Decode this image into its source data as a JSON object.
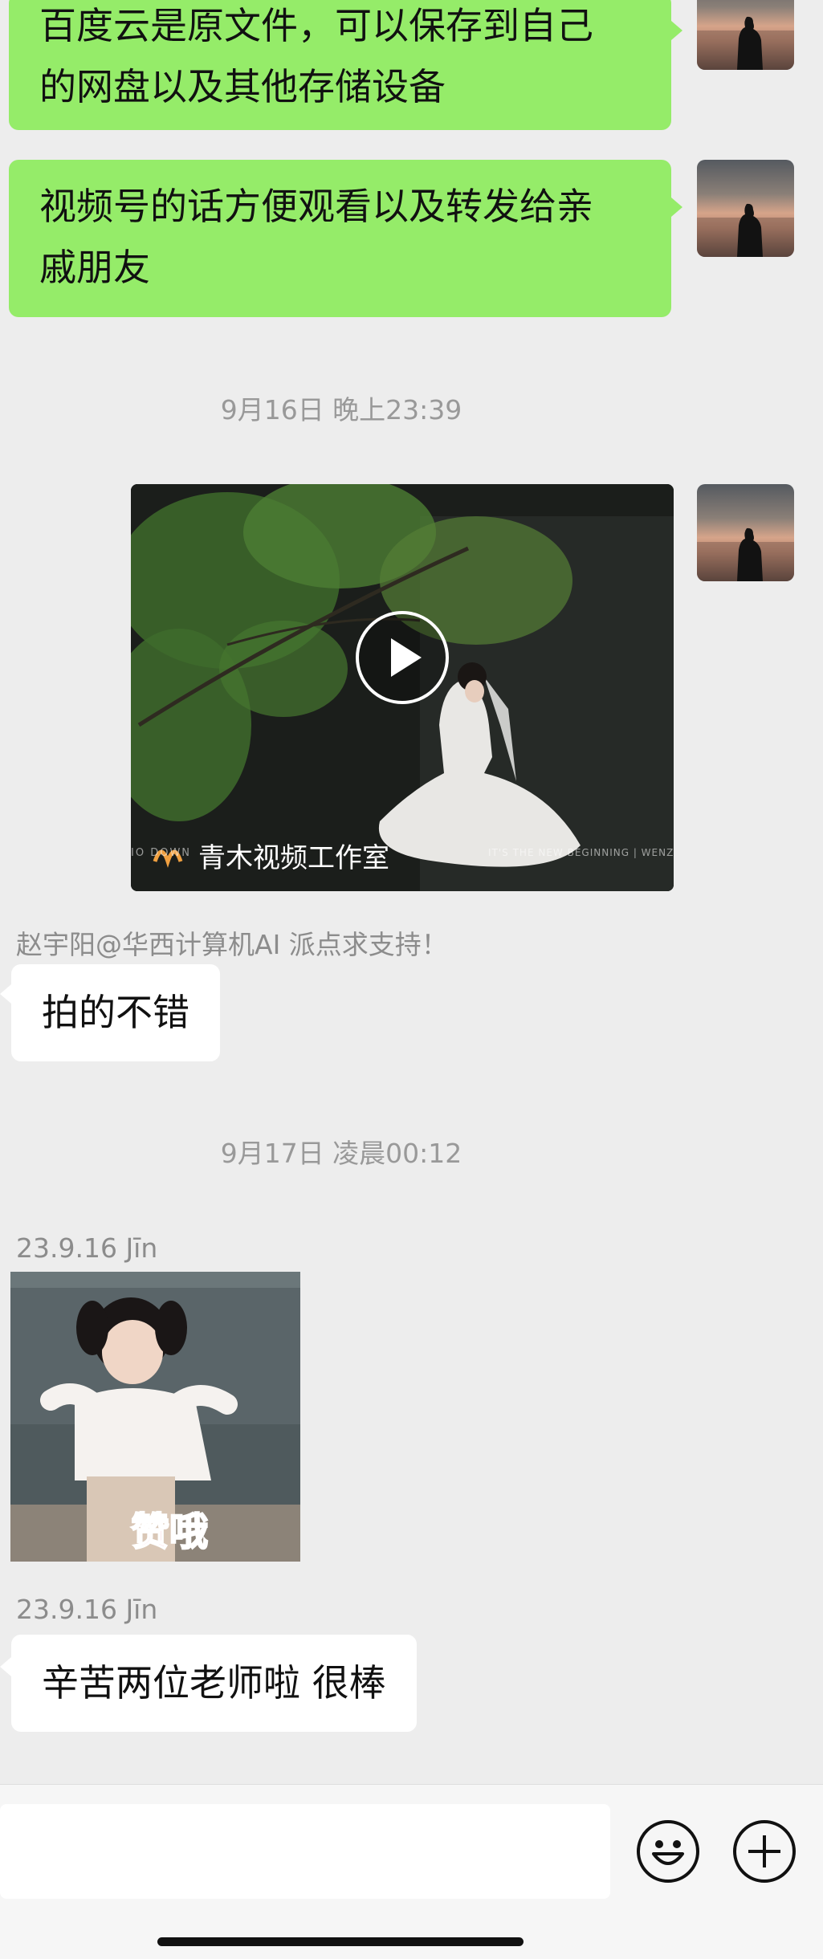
{
  "messages": {
    "m1_lines": [
      "百度云是原文件，可以保存到自己",
      "的网盘以及其他存储设备"
    ],
    "m2_lines": [
      "视频号的话方便观看以及转发给亲",
      "戚朋友"
    ],
    "timestamp1": "9月16日 晚上23:39",
    "video": {
      "channel_name": "青木视频工作室",
      "overlay_left": "IO DOWN",
      "overlay_right": "IT'S THE NEW BEGINNING | WENZ"
    },
    "sender_1": "赵宇阳@华西计算机AI 派点求支持！",
    "reply_1": "拍的不错",
    "timestamp2": "9月17日 凌晨00:12",
    "sender_2": "23.9.16 Jīn",
    "sticker_caption": "赞哦",
    "sender_3": "23.9.16 Jīn",
    "reply_2": "辛苦两位老师啦 很棒"
  },
  "input": {
    "placeholder": ""
  },
  "icons": {
    "emoji": "emoji-icon",
    "plus": "plus-icon",
    "play": "play-icon"
  },
  "colors": {
    "background": "#ededed",
    "my_bubble": "#95ec69",
    "their_bubble": "#ffffff",
    "meta_text": "#999999"
  }
}
